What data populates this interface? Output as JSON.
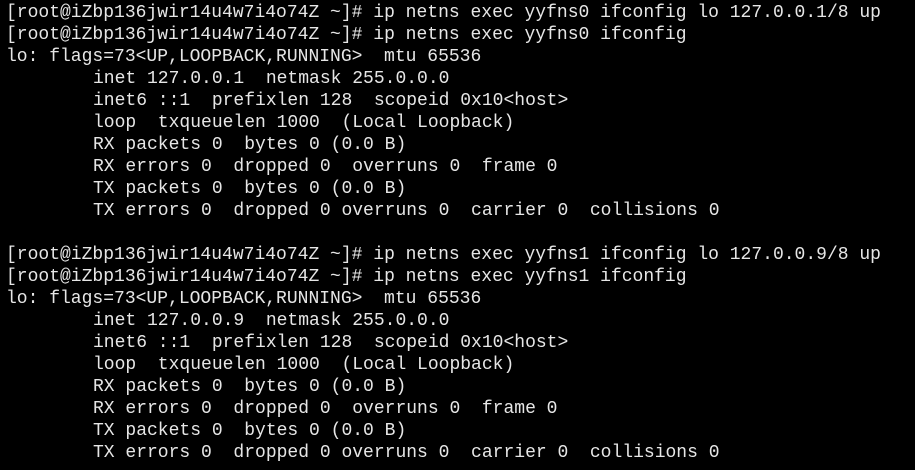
{
  "terminal": {
    "prompt": "[root@iZbp136jwir14u4w7i4o74Z ~]#",
    "blocks": [
      {
        "cmd_config": "ip netns exec yyfns0 ifconfig lo 127.0.0.1/8 up",
        "cmd_show": "ip netns exec yyfns0 ifconfig",
        "iface_line": "lo: flags=73<UP,LOOPBACK,RUNNING>  mtu 65536",
        "details": [
          "inet 127.0.0.1  netmask 255.0.0.0",
          "inet6 ::1  prefixlen 128  scopeid 0x10<host>",
          "loop  txqueuelen 1000  (Local Loopback)",
          "RX packets 0  bytes 0 (0.0 B)",
          "RX errors 0  dropped 0  overruns 0  frame 0",
          "TX packets 0  bytes 0 (0.0 B)",
          "TX errors 0  dropped 0 overruns 0  carrier 0  collisions 0"
        ]
      },
      {
        "cmd_config": "ip netns exec yyfns1 ifconfig lo 127.0.0.9/8 up",
        "cmd_show": "ip netns exec yyfns1 ifconfig",
        "iface_line": "lo: flags=73<UP,LOOPBACK,RUNNING>  mtu 65536",
        "details": [
          "inet 127.0.0.9  netmask 255.0.0.0",
          "inet6 ::1  prefixlen 128  scopeid 0x10<host>",
          "loop  txqueuelen 1000  (Local Loopback)",
          "RX packets 0  bytes 0 (0.0 B)",
          "RX errors 0  dropped 0  overruns 0  frame 0",
          "TX packets 0  bytes 0 (0.0 B)",
          "TX errors 0  dropped 0 overruns 0  carrier 0  collisions 0"
        ]
      }
    ]
  },
  "colors": {
    "background": "#000000",
    "text": "#e6e6e6"
  }
}
